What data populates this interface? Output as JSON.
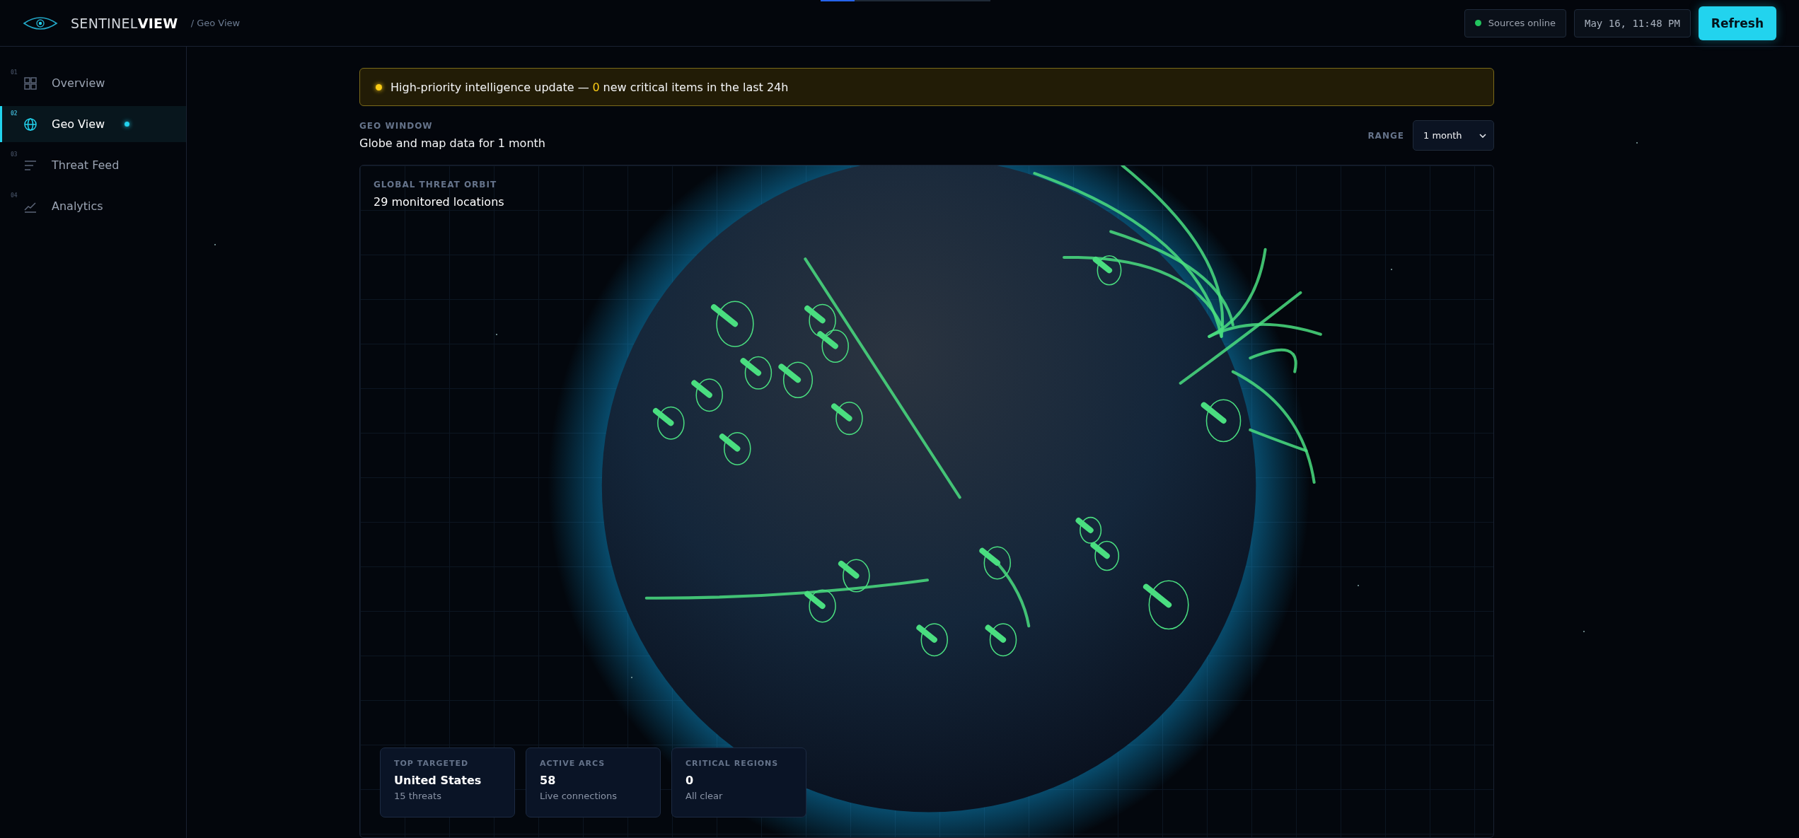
{
  "header": {
    "brand": "SENTINEL**VIEW**",
    "breadcrumb": "/ Geo View",
    "progress": {
      "level": 0.2
    },
    "status": {
      "label": "Sources online",
      "color": "#22c55e"
    },
    "datetime": "May 16, 11:48 PM",
    "refresh_button": "Refresh"
  },
  "sidebar": {
    "items": [
      {
        "number": "01",
        "label": "Overview",
        "selected": false
      },
      {
        "number": "02",
        "label": "Geo View",
        "selected": true
      },
      {
        "number": "03",
        "label": "Threat Feed",
        "selected": false
      },
      {
        "number": "04",
        "label": "Analytics",
        "selected": false
      }
    ]
  },
  "alert": {
    "prefix": "High-priority intelligence update —",
    "count": "0",
    "suffix": "new critical items in the last 24h"
  },
  "geo_window": {
    "eyebrow": "GEO WINDOW",
    "title": "Globe and map data for 1 month",
    "range_label": "RANGE",
    "range_value": "1 month"
  },
  "globe_card": {
    "eyebrow": "GLOBAL THREAT ORBIT",
    "title": "29 monitored locations",
    "stats": [
      {
        "label": "TOP TARGETED",
        "value": "United States",
        "detail": "15 threats"
      },
      {
        "label": "ACTIVE ARCS",
        "value": "58",
        "detail": "Live connections"
      },
      {
        "label": "CRITICAL REGIONS",
        "value": "0",
        "detail": "All clear"
      }
    ]
  }
}
